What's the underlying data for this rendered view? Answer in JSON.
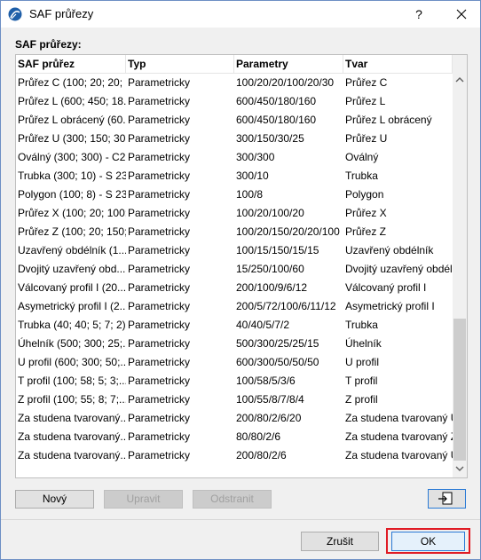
{
  "window": {
    "title": "SAF průřezy",
    "help_label": "?",
    "group_label": "SAF průřezy:"
  },
  "table": {
    "columns": [
      "SAF průřez",
      "Typ",
      "Parametry",
      "Tvar"
    ],
    "rows": [
      [
        "Průřez C (100; 20; 20; ...",
        "Parametricky",
        "100/20/20/100/20/30",
        "Průřez C"
      ],
      [
        "Průřez L (600; 450; 18...",
        "Parametricky",
        "600/450/180/160",
        "Průřez L"
      ],
      [
        "Průřez L obrácený (60...",
        "Parametricky",
        "600/450/180/160",
        "Průřez L obrácený"
      ],
      [
        "Průřez U (300; 150; 30...",
        "Parametricky",
        "300/150/30/25",
        "Průřez U"
      ],
      [
        "Oválný (300; 300) - C2...",
        "Parametricky",
        "300/300",
        "Oválný"
      ],
      [
        "Trubka (300; 10) - S 235",
        "Parametricky",
        "300/10",
        "Trubka"
      ],
      [
        "Polygon (100; 8) - S 235",
        "Parametricky",
        "100/8",
        "Polygon"
      ],
      [
        "Průřez X (100; 20; 100;...",
        "Parametricky",
        "100/20/100/20",
        "Průřez X"
      ],
      [
        "Průřez Z (100; 20; 150;...",
        "Parametricky",
        "100/20/150/20/20/100",
        "Průřez Z"
      ],
      [
        "Uzavřený obdélník (1...",
        "Parametricky",
        "100/15/150/15/15",
        "Uzavřený obdélník"
      ],
      [
        "Dvojitý uzavřený obd...",
        "Parametricky",
        "15/250/100/60",
        "Dvojitý uzavřený obdél"
      ],
      [
        "Válcovaný profil I (20...",
        "Parametricky",
        "200/100/9/6/12",
        "Válcovaný profil I"
      ],
      [
        "Asymetrický profil I (2...",
        "Parametricky",
        "200/5/72/100/6/11/12",
        "Asymetrický profil I"
      ],
      [
        "Trubka (40; 40; 5; 7; 2)...",
        "Parametricky",
        "40/40/5/7/2",
        "Trubka"
      ],
      [
        "Úhelník (500; 300; 25;...",
        "Parametricky",
        "500/300/25/25/15",
        "Úhelník"
      ],
      [
        "U profil (600; 300; 50;...",
        "Parametricky",
        "600/300/50/50/50",
        "U profil"
      ],
      [
        "T profil (100; 58; 5; 3;...",
        "Parametricky",
        "100/58/5/3/6",
        "T profil"
      ],
      [
        "Z profil (100; 55; 8; 7;...",
        "Parametricky",
        "100/55/8/7/8/4",
        "Z profil"
      ],
      [
        "Za studena tvarovaný...",
        "Parametricky",
        "200/80/2/6/20",
        "Za studena tvarovaný U"
      ],
      [
        "Za studena tvarovaný...",
        "Parametricky",
        "80/80/2/6",
        "Za studena tvarovaný Z"
      ],
      [
        "Za studena tvarovaný...",
        "Parametricky",
        "200/80/2/6",
        "Za studena tvarovaný U"
      ]
    ]
  },
  "buttons": {
    "new": "Nový",
    "edit": "Upravit",
    "delete": "Odstranit",
    "cancel": "Zrušit",
    "ok": "OK"
  },
  "colors": {
    "accent": "#2a7ad5",
    "highlight": "#e01b24",
    "window_border": "#6d8fc4"
  },
  "icons": {
    "app": "archicad-logo-icon",
    "export": "export-icon"
  }
}
